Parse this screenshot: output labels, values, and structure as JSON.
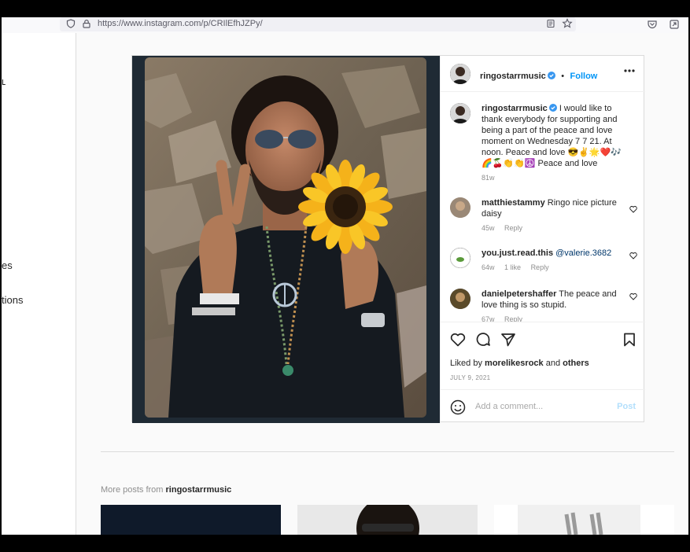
{
  "browser": {
    "url": "https://www.instagram.com/p/CRIlEfhJZPy/"
  },
  "leftnav": {
    "fragments": [
      "ʟ",
      "es",
      "tions"
    ]
  },
  "post": {
    "username": "ringostarrmusic",
    "follow_label": "Follow",
    "separator": "•",
    "caption": {
      "username": "ringostarrmusic",
      "text": "I would like to thank everybody for supporting and being a part of the peace and love moment on Wednesday 7 7 21. At noon.  Peace and love 😎✌️🌟❤️🎶🌈🍒👏👏☮️ Peace and love",
      "time": "81w"
    },
    "comments": [
      {
        "username": "matthiestammy",
        "text": "Ringo nice picture daisy",
        "time": "45w",
        "likes": "",
        "reply": "Reply"
      },
      {
        "username": "you.just.read.this",
        "text": "",
        "mention": "@valerie.3682",
        "time": "64w",
        "likes": "1 like",
        "reply": "Reply"
      },
      {
        "username": "danielpetershaffer",
        "text": "The peace and love thing is so stupid.",
        "time": "67w",
        "likes": "",
        "reply": "Reply"
      }
    ],
    "liked_by_prefix": "Liked by",
    "liked_by_user": "morelikesrock",
    "liked_by_and": "and",
    "liked_by_others": "others",
    "date": "JULY 9, 2021",
    "add_comment_placeholder": "Add a comment...",
    "post_button": "Post"
  },
  "more_posts": {
    "prefix": "More posts from",
    "username": "ringostarrmusic"
  },
  "colors": {
    "accent": "#0095f6",
    "verified": "#3897f0",
    "photo_border": "#1f2a34"
  }
}
